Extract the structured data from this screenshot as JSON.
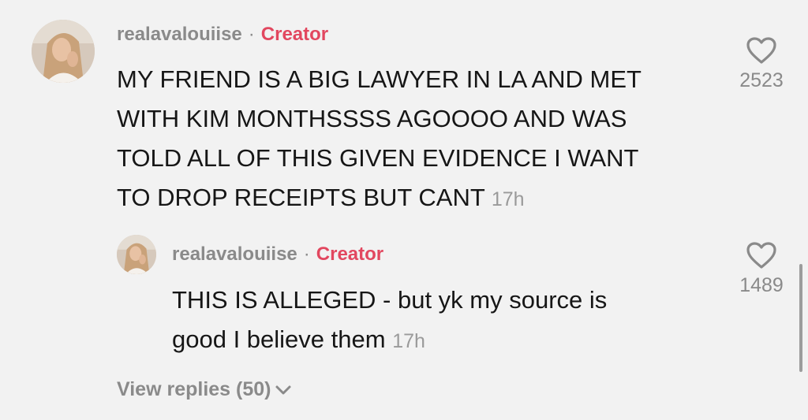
{
  "comments": [
    {
      "username": "realavalouiise",
      "separator": "·",
      "badge": "Creator",
      "lines": [
        "MY FRIEND IS A BIG LAWYER IN LA AND MET",
        "WITH KIM MONTHSSSS AGOOOO AND WAS",
        "TOLD ALL OF THIS GIVEN EVIDENCE I WANT",
        "TO DROP RECEIPTS BUT CANT"
      ],
      "time": "17h",
      "likes": "2523",
      "like_icon": "heart-outline-icon"
    }
  ],
  "replies": [
    {
      "username": "realavalouiise",
      "separator": "·",
      "badge": "Creator",
      "lines": [
        "THIS IS ALLEGED - but yk my source is",
        "good I believe them"
      ],
      "time": "17h",
      "likes": "1489",
      "like_icon": "heart-outline-icon"
    }
  ],
  "view_replies": {
    "label": "View replies (50)",
    "icon": "chevron-down-icon"
  },
  "colors": {
    "background": "#f2f2f2",
    "username": "#8a8a8a",
    "creator_badge": "#e2475f",
    "text": "#161616",
    "muted": "#9a9a9a"
  }
}
